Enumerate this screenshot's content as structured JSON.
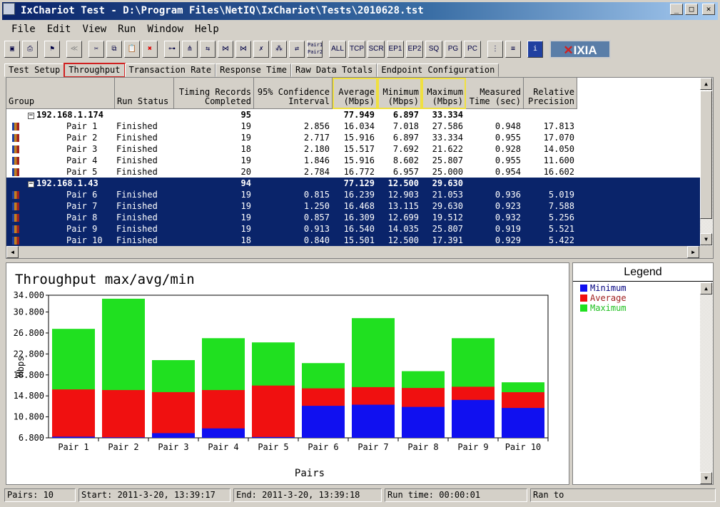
{
  "window": {
    "title": "IxChariot Test - D:\\Program Files\\NetIQ\\IxChariot\\Tests\\2010628.tst",
    "min": "_",
    "max": "□",
    "close": "✕"
  },
  "menu": [
    "File",
    "Edit",
    "View",
    "Run",
    "Window",
    "Help"
  ],
  "toolbar": {
    "text_buttons": [
      "ALL",
      "TCP",
      "SCR",
      "EP1",
      "EP2",
      "SQ",
      "PG",
      "PC"
    ],
    "pair_button": "Pair1 Pair2",
    "logo": "IXIA"
  },
  "tabs": [
    "Test Setup",
    "Throughput",
    "Transaction Rate",
    "Response Time",
    "Raw Data Totals",
    "Endpoint Configuration"
  ],
  "table": {
    "headers": [
      "Group",
      "Run Status",
      "Timing Records\nCompleted",
      "95% Confidence\nInterval",
      "Average\n(Mbps)",
      "Minimum\n(Mbps)",
      "Maximum\n(Mbps)",
      "Measured\nTime (sec)",
      "Relative\nPrecision"
    ],
    "rows": [
      {
        "group": true,
        "name": "192.168.1.174",
        "status": "",
        "records": "95",
        "ci": "",
        "avg": "77.949",
        "min": "6.897",
        "max": "33.334",
        "time": "",
        "prec": ""
      },
      {
        "name": "Pair 1",
        "status": "Finished",
        "records": "19",
        "ci": "2.856",
        "avg": "16.034",
        "min": "7.018",
        "max": "27.586",
        "time": "0.948",
        "prec": "17.813"
      },
      {
        "name": "Pair 2",
        "status": "Finished",
        "records": "19",
        "ci": "2.717",
        "avg": "15.916",
        "min": "6.897",
        "max": "33.334",
        "time": "0.955",
        "prec": "17.070"
      },
      {
        "name": "Pair 3",
        "status": "Finished",
        "records": "18",
        "ci": "2.180",
        "avg": "15.517",
        "min": "7.692",
        "max": "21.622",
        "time": "0.928",
        "prec": "14.050"
      },
      {
        "name": "Pair 4",
        "status": "Finished",
        "records": "19",
        "ci": "1.846",
        "avg": "15.916",
        "min": "8.602",
        "max": "25.807",
        "time": "0.955",
        "prec": "11.600"
      },
      {
        "name": "Pair 5",
        "status": "Finished",
        "records": "20",
        "ci": "2.784",
        "avg": "16.772",
        "min": "6.957",
        "max": "25.000",
        "time": "0.954",
        "prec": "16.602"
      },
      {
        "group": true,
        "sel": true,
        "name": "192.168.1.43",
        "status": "",
        "records": "94",
        "ci": "",
        "avg": "77.129",
        "min": "12.500",
        "max": "29.630",
        "time": "",
        "prec": ""
      },
      {
        "sel": true,
        "name": "Pair 6",
        "status": "Finished",
        "records": "19",
        "ci": "0.815",
        "avg": "16.239",
        "min": "12.903",
        "max": "21.053",
        "time": "0.936",
        "prec": "5.019"
      },
      {
        "sel": true,
        "name": "Pair 7",
        "status": "Finished",
        "records": "19",
        "ci": "1.250",
        "avg": "16.468",
        "min": "13.115",
        "max": "29.630",
        "time": "0.923",
        "prec": "7.588"
      },
      {
        "sel": true,
        "name": "Pair 8",
        "status": "Finished",
        "records": "19",
        "ci": "0.857",
        "avg": "16.309",
        "min": "12.699",
        "max": "19.512",
        "time": "0.932",
        "prec": "5.256"
      },
      {
        "sel": true,
        "name": "Pair 9",
        "status": "Finished",
        "records": "19",
        "ci": "0.913",
        "avg": "16.540",
        "min": "14.035",
        "max": "25.807",
        "time": "0.919",
        "prec": "5.521"
      },
      {
        "sel": true,
        "name": "Pair 10",
        "status": "Finished",
        "records": "18",
        "ci": "0.840",
        "avg": "15.501",
        "min": "12.500",
        "max": "17.391",
        "time": "0.929",
        "prec": "5.422"
      }
    ]
  },
  "chart_data": {
    "type": "bar",
    "title": "Throughput max/avg/min",
    "xlabel": "Pairs",
    "ylabel": "Mbps",
    "ylim": [
      6.8,
      34.0
    ],
    "yticks": [
      "6.800",
      "10.800",
      "14.800",
      "18.800",
      "22.800",
      "26.800",
      "30.800",
      "34.000"
    ],
    "categories": [
      "Pair 1",
      "Pair 2",
      "Pair 3",
      "Pair 4",
      "Pair 5",
      "Pair 6",
      "Pair 7",
      "Pair 8",
      "Pair 9",
      "Pair 10"
    ],
    "series": [
      {
        "name": "Maximum",
        "color": "#20e020",
        "values": [
          27.586,
          33.334,
          21.622,
          25.807,
          25.0,
          21.053,
          29.63,
          19.512,
          25.807,
          17.391
        ]
      },
      {
        "name": "Average",
        "color": "#f01010",
        "values": [
          16.034,
          15.916,
          15.517,
          15.916,
          16.772,
          16.239,
          16.468,
          16.309,
          16.54,
          15.501
        ]
      },
      {
        "name": "Minimum",
        "color": "#1010f0",
        "values": [
          7.018,
          6.897,
          7.692,
          8.602,
          6.957,
          12.903,
          13.115,
          12.699,
          14.035,
          12.5
        ]
      }
    ]
  },
  "legend": {
    "title": "Legend",
    "items": [
      {
        "label": "Minimum",
        "color": "#1010f0",
        "text": "#000080"
      },
      {
        "label": "Average",
        "color": "#f01010",
        "text": "#a02020"
      },
      {
        "label": "Maximum",
        "color": "#20e020",
        "text": "#20c020"
      }
    ]
  },
  "status": [
    "Pairs: 10",
    "Start: 2011-3-20, 13:39:17",
    "End: 2011-3-20, 13:39:18",
    "Run time: 00:00:01",
    "Ran to"
  ]
}
